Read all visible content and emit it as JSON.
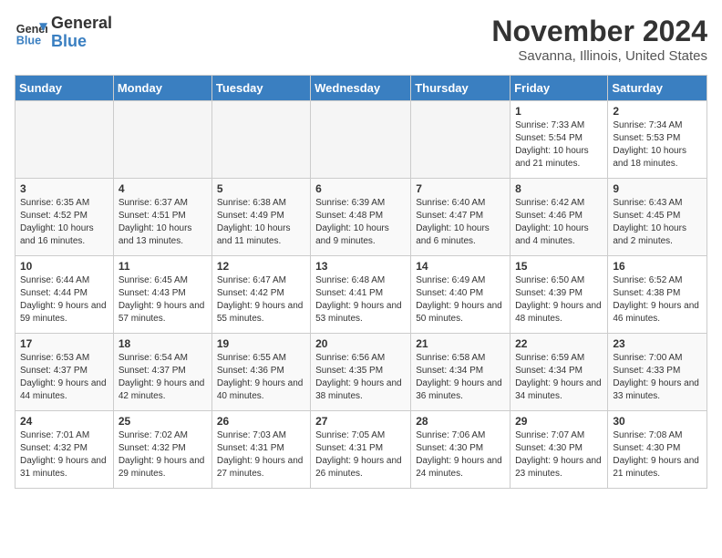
{
  "logo": {
    "line1": "General",
    "line2": "Blue"
  },
  "title": "November 2024",
  "location": "Savanna, Illinois, United States",
  "headers": [
    "Sunday",
    "Monday",
    "Tuesday",
    "Wednesday",
    "Thursday",
    "Friday",
    "Saturday"
  ],
  "weeks": [
    [
      {
        "day": "",
        "info": ""
      },
      {
        "day": "",
        "info": ""
      },
      {
        "day": "",
        "info": ""
      },
      {
        "day": "",
        "info": ""
      },
      {
        "day": "",
        "info": ""
      },
      {
        "day": "1",
        "info": "Sunrise: 7:33 AM\nSunset: 5:54 PM\nDaylight: 10 hours and 21 minutes."
      },
      {
        "day": "2",
        "info": "Sunrise: 7:34 AM\nSunset: 5:53 PM\nDaylight: 10 hours and 18 minutes."
      }
    ],
    [
      {
        "day": "3",
        "info": "Sunrise: 6:35 AM\nSunset: 4:52 PM\nDaylight: 10 hours and 16 minutes."
      },
      {
        "day": "4",
        "info": "Sunrise: 6:37 AM\nSunset: 4:51 PM\nDaylight: 10 hours and 13 minutes."
      },
      {
        "day": "5",
        "info": "Sunrise: 6:38 AM\nSunset: 4:49 PM\nDaylight: 10 hours and 11 minutes."
      },
      {
        "day": "6",
        "info": "Sunrise: 6:39 AM\nSunset: 4:48 PM\nDaylight: 10 hours and 9 minutes."
      },
      {
        "day": "7",
        "info": "Sunrise: 6:40 AM\nSunset: 4:47 PM\nDaylight: 10 hours and 6 minutes."
      },
      {
        "day": "8",
        "info": "Sunrise: 6:42 AM\nSunset: 4:46 PM\nDaylight: 10 hours and 4 minutes."
      },
      {
        "day": "9",
        "info": "Sunrise: 6:43 AM\nSunset: 4:45 PM\nDaylight: 10 hours and 2 minutes."
      }
    ],
    [
      {
        "day": "10",
        "info": "Sunrise: 6:44 AM\nSunset: 4:44 PM\nDaylight: 9 hours and 59 minutes."
      },
      {
        "day": "11",
        "info": "Sunrise: 6:45 AM\nSunset: 4:43 PM\nDaylight: 9 hours and 57 minutes."
      },
      {
        "day": "12",
        "info": "Sunrise: 6:47 AM\nSunset: 4:42 PM\nDaylight: 9 hours and 55 minutes."
      },
      {
        "day": "13",
        "info": "Sunrise: 6:48 AM\nSunset: 4:41 PM\nDaylight: 9 hours and 53 minutes."
      },
      {
        "day": "14",
        "info": "Sunrise: 6:49 AM\nSunset: 4:40 PM\nDaylight: 9 hours and 50 minutes."
      },
      {
        "day": "15",
        "info": "Sunrise: 6:50 AM\nSunset: 4:39 PM\nDaylight: 9 hours and 48 minutes."
      },
      {
        "day": "16",
        "info": "Sunrise: 6:52 AM\nSunset: 4:38 PM\nDaylight: 9 hours and 46 minutes."
      }
    ],
    [
      {
        "day": "17",
        "info": "Sunrise: 6:53 AM\nSunset: 4:37 PM\nDaylight: 9 hours and 44 minutes."
      },
      {
        "day": "18",
        "info": "Sunrise: 6:54 AM\nSunset: 4:37 PM\nDaylight: 9 hours and 42 minutes."
      },
      {
        "day": "19",
        "info": "Sunrise: 6:55 AM\nSunset: 4:36 PM\nDaylight: 9 hours and 40 minutes."
      },
      {
        "day": "20",
        "info": "Sunrise: 6:56 AM\nSunset: 4:35 PM\nDaylight: 9 hours and 38 minutes."
      },
      {
        "day": "21",
        "info": "Sunrise: 6:58 AM\nSunset: 4:34 PM\nDaylight: 9 hours and 36 minutes."
      },
      {
        "day": "22",
        "info": "Sunrise: 6:59 AM\nSunset: 4:34 PM\nDaylight: 9 hours and 34 minutes."
      },
      {
        "day": "23",
        "info": "Sunrise: 7:00 AM\nSunset: 4:33 PM\nDaylight: 9 hours and 33 minutes."
      }
    ],
    [
      {
        "day": "24",
        "info": "Sunrise: 7:01 AM\nSunset: 4:32 PM\nDaylight: 9 hours and 31 minutes."
      },
      {
        "day": "25",
        "info": "Sunrise: 7:02 AM\nSunset: 4:32 PM\nDaylight: 9 hours and 29 minutes."
      },
      {
        "day": "26",
        "info": "Sunrise: 7:03 AM\nSunset: 4:31 PM\nDaylight: 9 hours and 27 minutes."
      },
      {
        "day": "27",
        "info": "Sunrise: 7:05 AM\nSunset: 4:31 PM\nDaylight: 9 hours and 26 minutes."
      },
      {
        "day": "28",
        "info": "Sunrise: 7:06 AM\nSunset: 4:30 PM\nDaylight: 9 hours and 24 minutes."
      },
      {
        "day": "29",
        "info": "Sunrise: 7:07 AM\nSunset: 4:30 PM\nDaylight: 9 hours and 23 minutes."
      },
      {
        "day": "30",
        "info": "Sunrise: 7:08 AM\nSunset: 4:30 PM\nDaylight: 9 hours and 21 minutes."
      }
    ]
  ]
}
